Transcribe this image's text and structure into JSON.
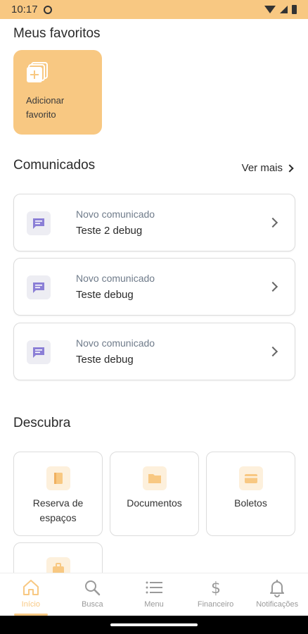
{
  "status_bar": {
    "time": "10:17"
  },
  "favorites": {
    "title": "Meus favoritos",
    "add_card_label": "Adicionar favorito"
  },
  "comunicados": {
    "title": "Comunicados",
    "see_more": "Ver mais",
    "items": [
      {
        "subtitle": "Novo comunicado",
        "title": "Teste 2 debug"
      },
      {
        "subtitle": "Novo comunicado",
        "title": "Teste debug"
      },
      {
        "subtitle": "Novo comunicado",
        "title": "Teste debug"
      }
    ]
  },
  "descubra": {
    "title": "Descubra",
    "items": [
      {
        "label": "Reserva de espaços",
        "icon": "book-icon"
      },
      {
        "label": "Documentos",
        "icon": "folder-icon"
      },
      {
        "label": "Boletos",
        "icon": "card-icon"
      },
      {
        "label": "",
        "icon": "briefcase-icon"
      }
    ]
  },
  "bottom_nav": {
    "items": [
      {
        "label": "Início",
        "icon": "home-icon",
        "active": true
      },
      {
        "label": "Busca",
        "icon": "search-icon",
        "active": false
      },
      {
        "label": "Menu",
        "icon": "menu-icon",
        "active": false
      },
      {
        "label": "Financeiro",
        "icon": "dollar-icon",
        "active": false
      },
      {
        "label": "Notificações",
        "icon": "bell-icon",
        "active": false
      }
    ]
  },
  "colors": {
    "accent": "#f8c882",
    "message_icon": "#8b7fd6",
    "muted_text": "#6f7b8a"
  }
}
